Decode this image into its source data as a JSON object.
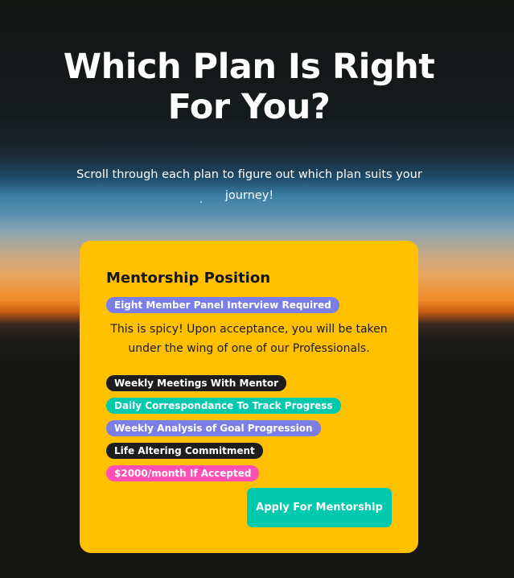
{
  "hero": {
    "title_line1": "Which Plan Is Right",
    "title_line2": "For You?",
    "subtitle": "Scroll through each plan to figure out which plan suits your journey!"
  },
  "plan_card": {
    "title": "Mentorship Position",
    "requirement_badge": "Eight Member Panel Interview Required",
    "description": "This is spicy! Upon acceptance, you will be taken under the wing of one of our Professionals.",
    "features": [
      {
        "label": "Weekly Meetings With Mentor",
        "color": "#1e1e1e"
      },
      {
        "label": "Daily Correspondance To Track Progress",
        "color": "#00c9ad"
      },
      {
        "label": "Weekly Analysis of Goal Progression",
        "color": "#7b7ee6"
      },
      {
        "label": "Life Altering Commitment",
        "color": "#1e1e1e"
      },
      {
        "label": "$2000/month If Accepted",
        "color": "#ff4fb5"
      }
    ],
    "apply_label": "Apply For Mentorship"
  },
  "colors": {
    "card_background": "#ffc000",
    "requirement_badge": "#7b7ee6",
    "apply_button": "#00c9ad",
    "page_background": "#151614"
  }
}
